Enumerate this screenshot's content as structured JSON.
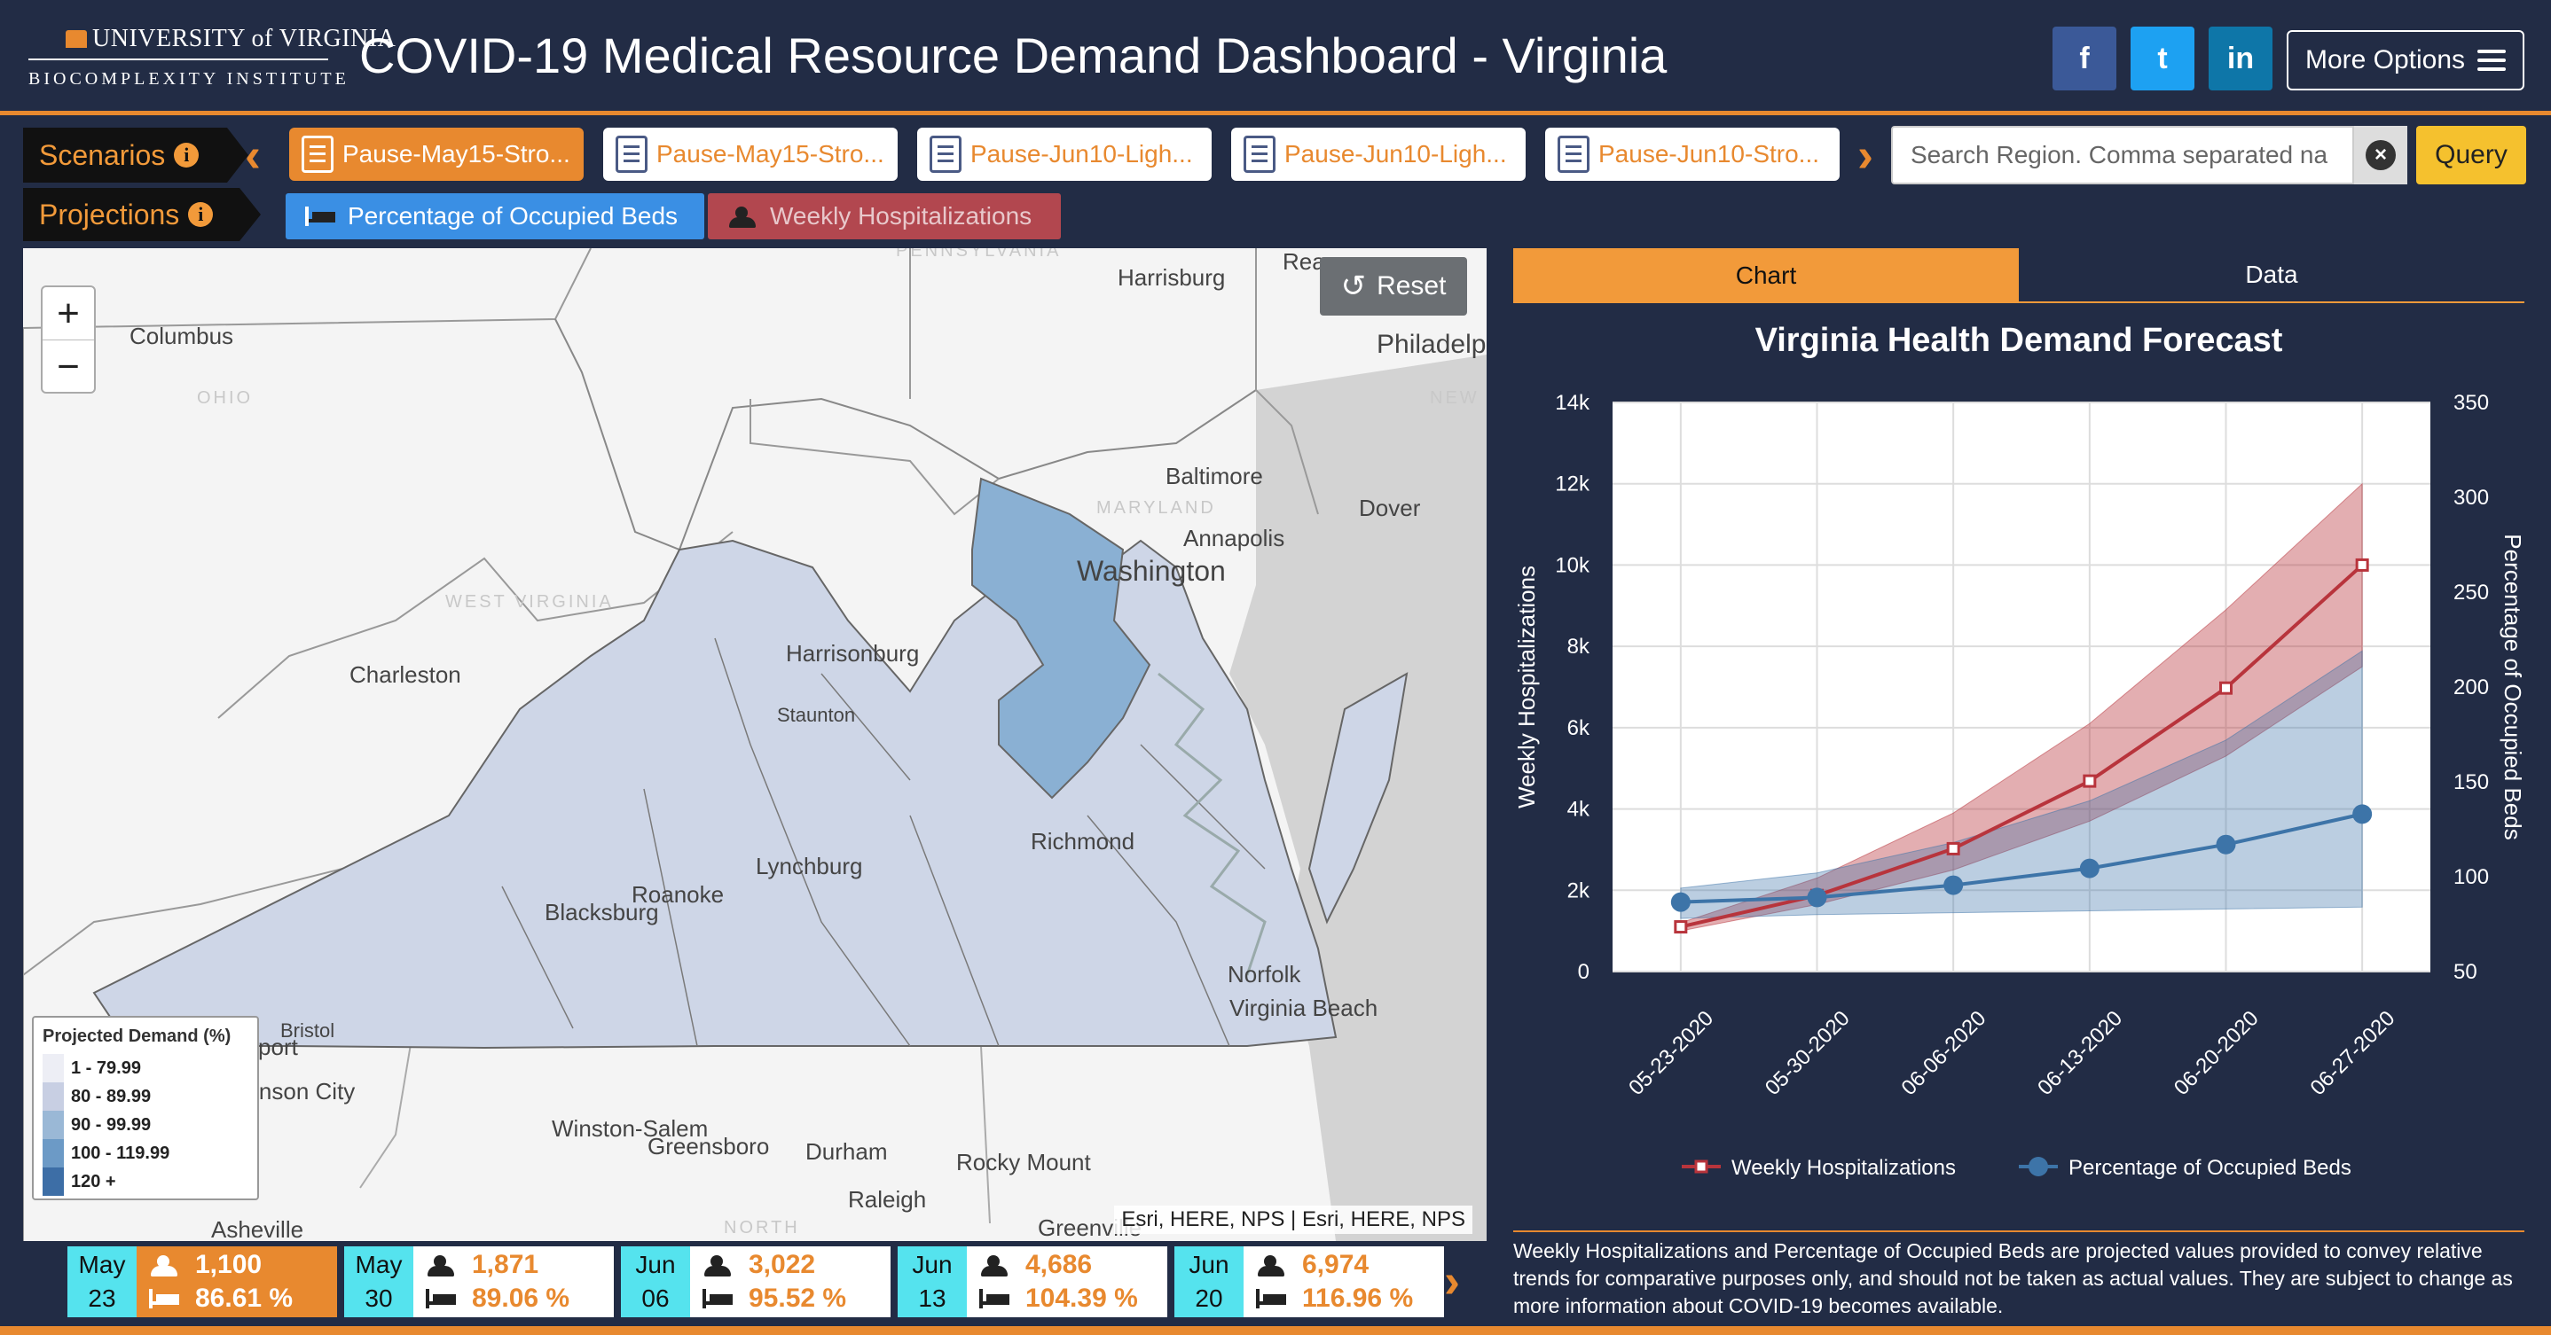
{
  "header": {
    "logo_top": "UNIVERSITY of VIRGINIA",
    "logo_bottom": "BIOCOMPLEXITY INSTITUTE",
    "title": "COVID-19 Medical Resource Demand Dashboard - Virginia",
    "social": [
      "f",
      "t",
      "in"
    ],
    "more_options": "More Options"
  },
  "scenarios": {
    "label": "Scenarios",
    "items": [
      {
        "label": "Pause-May15-Stro...",
        "selected": true
      },
      {
        "label": "Pause-May15-Stro...",
        "selected": false
      },
      {
        "label": "Pause-Jun10-Ligh...",
        "selected": false
      },
      {
        "label": "Pause-Jun10-Ligh...",
        "selected": false
      },
      {
        "label": "Pause-Jun10-Stro...",
        "selected": false
      }
    ]
  },
  "search": {
    "placeholder": "Search Region. Comma separated na",
    "query_label": "Query"
  },
  "projections": {
    "label": "Projections",
    "items": [
      {
        "label": "Percentage of Occupied Beds",
        "color": "#3a8fe4"
      },
      {
        "label": "Weekly Hospitalizations",
        "color": "#b2474f"
      }
    ]
  },
  "map": {
    "reset_label": "Reset",
    "attribution": "Esri, HERE, NPS | Esri, HERE, NPS",
    "labels": [
      "Columbus",
      "OHIO",
      "Harrisburg",
      "PENNSYLVANIA",
      "Philadelp",
      "NEW",
      "Baltimore",
      "MARYLAND",
      "Annapolis",
      "Dover",
      "Washington",
      "WEST VIRGINIA",
      "Charleston",
      "Harrisonburg",
      "Staunton",
      "Richmond",
      "Lynchburg",
      "Roanoke",
      "Blacksburg",
      "Norfolk",
      "Virginia Beach",
      "Bristol",
      "Kingsport",
      "Johnson City",
      "Winston-Salem",
      "Greensboro",
      "Durham",
      "Rocky Mount",
      "Raleigh",
      "Asheville",
      "NORTH",
      "Greenville",
      "Rea"
    ],
    "legend": {
      "title": "Projected Demand (%)",
      "items": [
        {
          "label": "1 - 79.99",
          "color": "#edeef5"
        },
        {
          "label": "80 - 89.99",
          "color": "#c8cfe3"
        },
        {
          "label": "90 - 99.99",
          "color": "#9ab8d6"
        },
        {
          "label": "100 - 119.99",
          "color": "#6c9ac6"
        },
        {
          "label": "120 +",
          "color": "#3d6ea6"
        }
      ]
    }
  },
  "dates": [
    {
      "month": "May",
      "day": "23",
      "hosp": "1,100",
      "beds": "86.61 %",
      "selected": true
    },
    {
      "month": "May",
      "day": "30",
      "hosp": "1,871",
      "beds": "89.06 %",
      "selected": false
    },
    {
      "month": "Jun",
      "day": "06",
      "hosp": "3,022",
      "beds": "95.52 %",
      "selected": false
    },
    {
      "month": "Jun",
      "day": "13",
      "hosp": "4,686",
      "beds": "104.39 %",
      "selected": false
    },
    {
      "month": "Jun",
      "day": "20",
      "hosp": "6,974",
      "beds": "116.96 %",
      "selected": false
    }
  ],
  "tabs": {
    "chart": "Chart",
    "data": "Data"
  },
  "chart_data": {
    "type": "line",
    "title": "Virginia Health Demand Forecast",
    "x": [
      "05-23-2020",
      "05-30-2020",
      "06-06-2020",
      "06-13-2020",
      "06-20-2020",
      "06-27-2020"
    ],
    "ylabel_left": "Weekly Hospitalizations",
    "ylabel_right": "Percentage of Occupied Beds",
    "y_left_ticks": [
      "0",
      "2k",
      "4k",
      "6k",
      "8k",
      "10k",
      "12k",
      "14k"
    ],
    "y_right_ticks": [
      "50",
      "100",
      "150",
      "200",
      "250",
      "300",
      "350"
    ],
    "ylim_left": [
      0,
      14000
    ],
    "ylim_right": [
      50,
      350
    ],
    "grid": true,
    "legend_position": "bottom",
    "series": [
      {
        "name": "Weekly Hospitalizations",
        "axis": "left",
        "color": "#b8343c",
        "values": [
          1100,
          1871,
          3022,
          4686,
          6974,
          10000
        ],
        "lower": [
          1000,
          1650,
          2500,
          3700,
          5300,
          7500
        ],
        "upper": [
          1200,
          2300,
          3900,
          6100,
          8900,
          12000
        ]
      },
      {
        "name": "Percentage of Occupied Beds",
        "axis": "right",
        "color": "#3d74a8",
        "values": [
          86.61,
          89.06,
          95.52,
          104.39,
          116.96,
          133
        ],
        "lower": [
          78,
          80,
          81,
          82,
          83,
          84
        ],
        "upper": [
          94,
          102,
          118,
          140,
          172,
          219
        ]
      }
    ]
  },
  "disclaimer": "Weekly Hospitalizations and Percentage of Occupied Beds are projected values provided to convey relative trends for comparative purposes only, and should not be taken as actual values. They are subject to change as more information about COVID-19 becomes available."
}
